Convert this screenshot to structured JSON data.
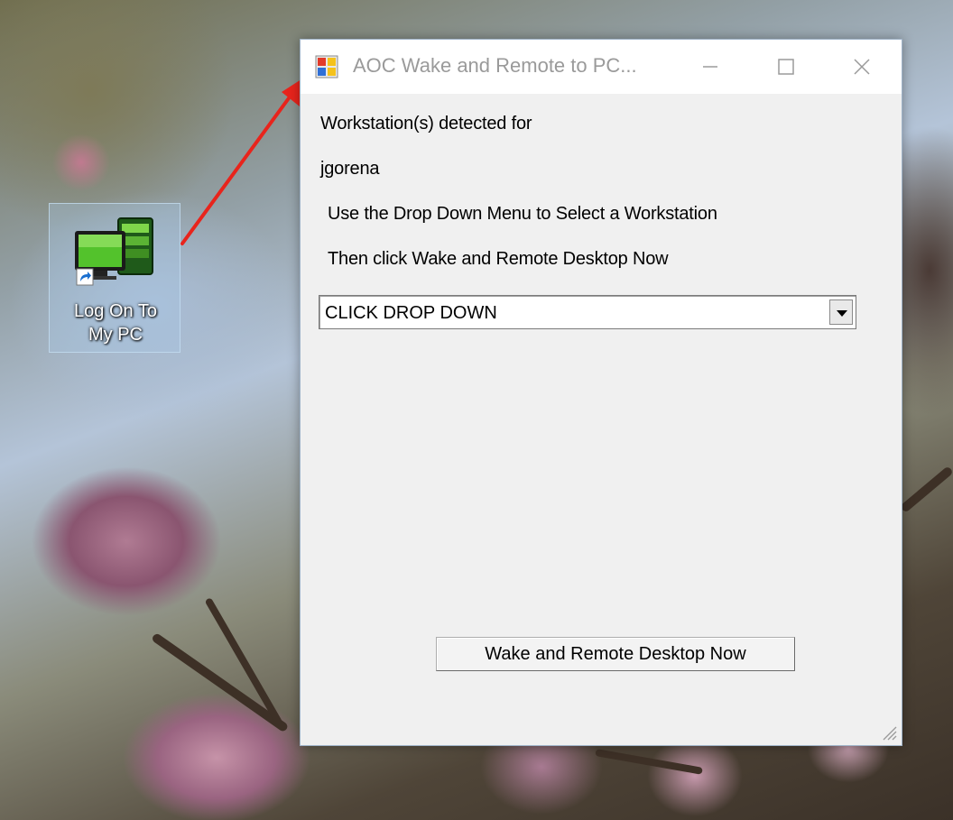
{
  "desktop": {
    "shortcut": {
      "label_line1": "Log On To",
      "label_line2": "My PC",
      "icon": "computer-monitor-shortcut-icon"
    },
    "annotation": {
      "icon": "red-arrow-icon",
      "color": "#e8241c"
    }
  },
  "window": {
    "title": "AOC Wake and Remote to PC...",
    "app_icon": "app-window-icon",
    "controls": {
      "minimize_icon": "minimize-icon",
      "maximize_icon": "maximize-icon",
      "close_icon": "close-icon"
    },
    "label_detected": "Workstation(s) detected for",
    "username": "jgorena",
    "instruction_1": "Use the Drop Down Menu to Select a Workstation",
    "instruction_2": "Then click Wake and Remote Desktop Now",
    "dropdown": {
      "selected": "CLICK DROP DOWN",
      "arrow_icon": "dropdown-arrow-icon"
    },
    "action_button": "Wake and Remote Desktop Now",
    "resize_grip_icon": "resize-grip-icon"
  },
  "colors": {
    "window_bg": "#f0f0f0",
    "titlebar_bg": "#ffffff",
    "title_text": "#9a9a9a"
  }
}
